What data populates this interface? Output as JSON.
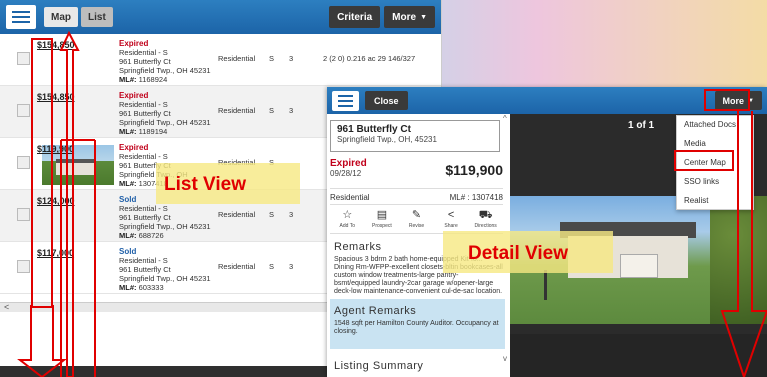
{
  "list_view": {
    "toolbar": {
      "map_label": "Map",
      "list_label": "List",
      "criteria_label": "Criteria",
      "more_label": "More"
    },
    "rows": [
      {
        "price": "$154,850",
        "status": "Expired",
        "status_kind": "expired",
        "class": "Residential - S",
        "address": "961 Butterfly Ct",
        "city": "Springfield Twp., OH 45231",
        "ml_label": "ML#:",
        "ml": "1168924",
        "type": "Residential",
        "s": "S",
        "bd": "3",
        "extra": "2 (2 0)  0.216 ac  29   146/327",
        "thumb": false
      },
      {
        "price": "$154,850",
        "status": "Expired",
        "status_kind": "expired",
        "class": "Residential - S",
        "address": "961 Butterfly Ct",
        "city": "Springfield Twp., OH 45231",
        "ml_label": "ML#:",
        "ml": "1189194",
        "type": "Residential",
        "s": "S",
        "bd": "3",
        "extra": "",
        "thumb": false
      },
      {
        "price": "$119,900",
        "status": "Expired",
        "status_kind": "expired",
        "class": "Residential - S",
        "address": "961 Butterfly Ct",
        "city": "Springfield Twp., OH",
        "ml_label": "ML#:",
        "ml": "1307418",
        "type": "Residential",
        "s": "S",
        "bd": "3",
        "extra": "",
        "thumb": true
      },
      {
        "price": "$124,000",
        "status": "Sold",
        "status_kind": "sold",
        "class": "Residential - S",
        "address": "961 Butterfly Ct",
        "city": "Springfield Twp., OH 45231",
        "ml_label": "ML#:",
        "ml": "688726",
        "type": "Residential",
        "s": "S",
        "bd": "3",
        "extra": "",
        "thumb": false
      },
      {
        "price": "$117,000",
        "status": "Sold",
        "status_kind": "sold",
        "class": "Residential - S",
        "address": "961 Butterfly Ct",
        "city": "Springfield Twp., OH 45231",
        "ml_label": "ML#:",
        "ml": "603333",
        "type": "Residential",
        "s": "S",
        "bd": "3",
        "extra": "",
        "thumb": false
      }
    ]
  },
  "detail_view": {
    "close_label": "Close",
    "more_label": "More",
    "address_line1": "961 Butterfly Ct",
    "address_line2": "Springfield Twp., OH, 45231",
    "status": "Expired",
    "date": "09/28/12",
    "price": "$119,900",
    "type": "Residential",
    "ml": "ML# : 1307418",
    "actions": [
      {
        "icon": "star-icon",
        "glyph": "☆",
        "label": "Add To"
      },
      {
        "icon": "card-icon",
        "glyph": "▤",
        "label": "Prospect"
      },
      {
        "icon": "wrench-icon",
        "glyph": "✎",
        "label": "Revise"
      },
      {
        "icon": "share-icon",
        "glyph": "<",
        "label": "Share"
      },
      {
        "icon": "car-icon",
        "glyph": "⛟",
        "label": "Directions"
      }
    ],
    "remarks_title": "Remarks",
    "remarks_text": "Spacious 3 bdrm 2 bath home-equipped Kit-fo... Dining Rm-WFPP-excellent closets-bltin bookcases-all custom window treatments-large pantry-bsmt/equipped laundry-2car garage w/opener-large deck-low maintenance-convenient cul-de-sac location.",
    "agent_remarks_title": "Agent Remarks",
    "agent_remarks_text": "1548 sqft per Hamilton County Auditor. Occupancy at closing.",
    "summary_title": "Listing Summary",
    "photo_counter": "1 of 1",
    "more_menu": [
      "Attached Docs",
      "Media",
      "Center Map",
      "SSO links",
      "Realist"
    ]
  },
  "annotations": {
    "list_view_label": "List View",
    "detail_view_label": "Detail View",
    "color": "#e00000"
  }
}
